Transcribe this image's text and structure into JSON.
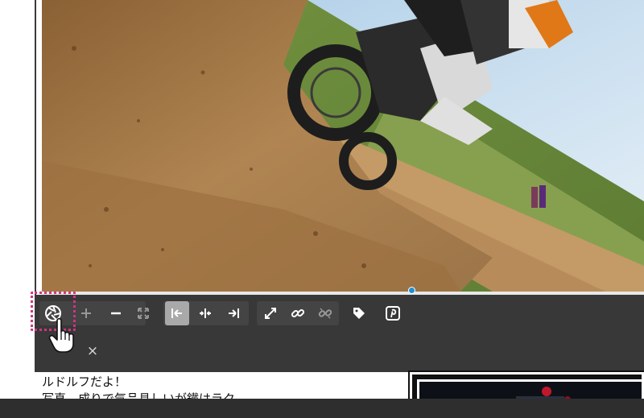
{
  "editor": {
    "image": {
      "description_icon": "motocross-photo",
      "alt": ""
    },
    "toolbar": {
      "buttons": [
        {
          "name": "aperture-icon",
          "label": ""
        },
        {
          "name": "add-icon",
          "label": ""
        },
        {
          "name": "remove-icon",
          "label": ""
        },
        {
          "name": "fullscreen-icon",
          "label": ""
        },
        {
          "name": "align-left-icon",
          "label": "",
          "active": true
        },
        {
          "name": "align-center-icon",
          "label": ""
        },
        {
          "name": "align-right-icon",
          "label": ""
        },
        {
          "name": "expand-icon",
          "label": ""
        },
        {
          "name": "link-icon",
          "label": ""
        },
        {
          "name": "unlink-icon",
          "label": ""
        },
        {
          "name": "tag-icon",
          "label": ""
        },
        {
          "name": "pinterest-icon",
          "label": ""
        }
      ],
      "close_label": "×"
    },
    "content": {
      "line1": "ルドルフだよ！",
      "line2": "写真…成りで気品具しいが鐵はラク…"
    },
    "colors": {
      "toolbar_bg": "#383838",
      "highlight": "#d2347f",
      "handle": "#1e90d6"
    }
  }
}
